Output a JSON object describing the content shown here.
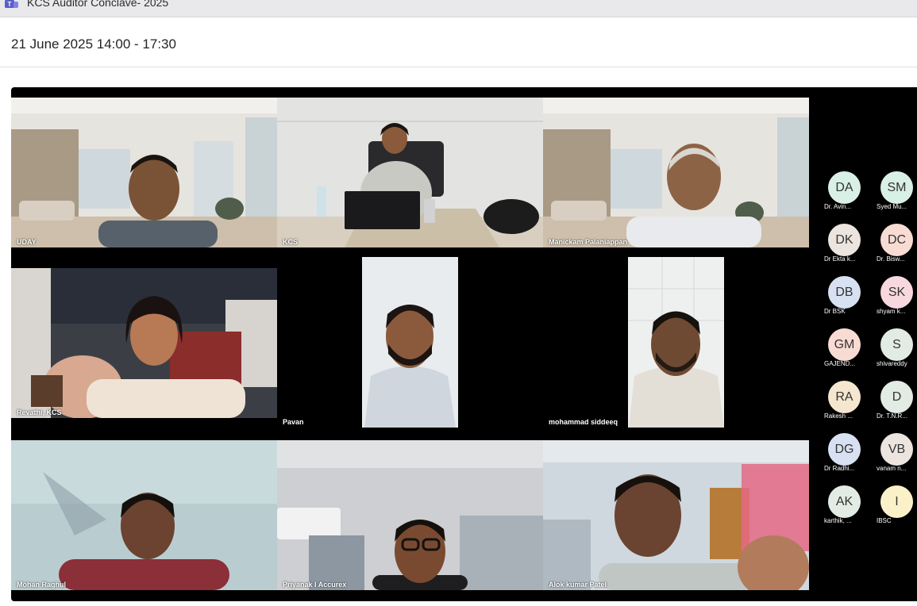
{
  "window": {
    "title": "KCS Auditor Conclave- 2025",
    "icon": "teams-icon"
  },
  "meeting": {
    "time_range": "21 June 2025 14:00 - 17:30"
  },
  "video_tiles": [
    {
      "name": "UDAY"
    },
    {
      "name": "KCS"
    },
    {
      "name": "Manickam Palaniappan"
    },
    {
      "name": "Revathi, KCS"
    },
    {
      "name": "Pavan"
    },
    {
      "name": "mohammad siddeeq"
    },
    {
      "name": "Mohan Raghul"
    },
    {
      "name": "Priyanak I Accurex"
    },
    {
      "name": "Alok kumar Patel"
    }
  ],
  "participants": [
    {
      "initials": "DA",
      "name": "Dr. Avin...",
      "color": "#d9f0e6"
    },
    {
      "initials": "SM",
      "name": "Syed Mu...",
      "color": "#d9f0e6"
    },
    {
      "initials": "DK",
      "name": "Dr Ekta k...",
      "color": "#ece4df"
    },
    {
      "initials": "DC",
      "name": "Dr. Bisw...",
      "color": "#f8dcd3"
    },
    {
      "initials": "DB",
      "name": "Dr BSK",
      "color": "#d7e1f2"
    },
    {
      "initials": "SK",
      "name": "shyam k...",
      "color": "#f7d8de"
    },
    {
      "initials": "GM",
      "name": "GAJEND...",
      "color": "#f8dcd3"
    },
    {
      "initials": "S",
      "name": "shivareddy",
      "color": "#e3ece4"
    },
    {
      "initials": "RA",
      "name": "Rakesh ...",
      "color": "#f5e6cf"
    },
    {
      "initials": "D",
      "name": "Dr. T.N.R...",
      "color": "#e3ece4"
    },
    {
      "initials": "DG",
      "name": "Dr Radhi...",
      "color": "#d7e1f2"
    },
    {
      "initials": "VB",
      "name": "vanam n...",
      "color": "#ece4df"
    },
    {
      "initials": "AK",
      "name": "karthik, ...",
      "color": "#e3ece4"
    },
    {
      "initials": "I",
      "name": "IBSC",
      "color": "#fbf1c9"
    }
  ]
}
